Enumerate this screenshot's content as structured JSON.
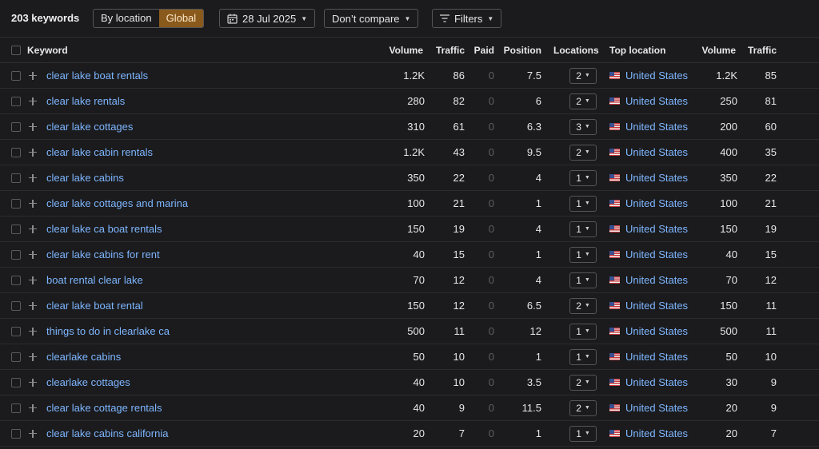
{
  "toolbar": {
    "count_label": "203 keywords",
    "by_location": "By location",
    "global": "Global",
    "date": "28 Jul 2025",
    "compare": "Don’t compare",
    "filters": "Filters"
  },
  "columns": {
    "keyword": "Keyword",
    "volume": "Volume",
    "traffic": "Traffic",
    "paid": "Paid",
    "position": "Position",
    "locations": "Locations",
    "top_location": "Top location",
    "top_volume": "Volume",
    "top_traffic": "Traffic"
  },
  "rows": [
    {
      "keyword": "clear lake boat rentals",
      "volume": "1.2K",
      "traffic": "86",
      "paid": "0",
      "position": "7.5",
      "locations": "2",
      "country": "United States",
      "top_volume": "1.2K",
      "top_traffic": "85"
    },
    {
      "keyword": "clear lake rentals",
      "volume": "280",
      "traffic": "82",
      "paid": "0",
      "position": "6",
      "locations": "2",
      "country": "United States",
      "top_volume": "250",
      "top_traffic": "81"
    },
    {
      "keyword": "clear lake cottages",
      "volume": "310",
      "traffic": "61",
      "paid": "0",
      "position": "6.3",
      "locations": "3",
      "country": "United States",
      "top_volume": "200",
      "top_traffic": "60"
    },
    {
      "keyword": "clear lake cabin rentals",
      "volume": "1.2K",
      "traffic": "43",
      "paid": "0",
      "position": "9.5",
      "locations": "2",
      "country": "United States",
      "top_volume": "400",
      "top_traffic": "35"
    },
    {
      "keyword": "clear lake cabins",
      "volume": "350",
      "traffic": "22",
      "paid": "0",
      "position": "4",
      "locations": "1",
      "country": "United States",
      "top_volume": "350",
      "top_traffic": "22"
    },
    {
      "keyword": "clear lake cottages and marina",
      "volume": "100",
      "traffic": "21",
      "paid": "0",
      "position": "1",
      "locations": "1",
      "country": "United States",
      "top_volume": "100",
      "top_traffic": "21"
    },
    {
      "keyword": "clear lake ca boat rentals",
      "volume": "150",
      "traffic": "19",
      "paid": "0",
      "position": "4",
      "locations": "1",
      "country": "United States",
      "top_volume": "150",
      "top_traffic": "19"
    },
    {
      "keyword": "clear lake cabins for rent",
      "volume": "40",
      "traffic": "15",
      "paid": "0",
      "position": "1",
      "locations": "1",
      "country": "United States",
      "top_volume": "40",
      "top_traffic": "15"
    },
    {
      "keyword": "boat rental clear lake",
      "volume": "70",
      "traffic": "12",
      "paid": "0",
      "position": "4",
      "locations": "1",
      "country": "United States",
      "top_volume": "70",
      "top_traffic": "12"
    },
    {
      "keyword": "clear lake boat rental",
      "volume": "150",
      "traffic": "12",
      "paid": "0",
      "position": "6.5",
      "locations": "2",
      "country": "United States",
      "top_volume": "150",
      "top_traffic": "11"
    },
    {
      "keyword": "things to do in clearlake ca",
      "volume": "500",
      "traffic": "11",
      "paid": "0",
      "position": "12",
      "locations": "1",
      "country": "United States",
      "top_volume": "500",
      "top_traffic": "11"
    },
    {
      "keyword": "clearlake cabins",
      "volume": "50",
      "traffic": "10",
      "paid": "0",
      "position": "1",
      "locations": "1",
      "country": "United States",
      "top_volume": "50",
      "top_traffic": "10"
    },
    {
      "keyword": "clearlake cottages",
      "volume": "40",
      "traffic": "10",
      "paid": "0",
      "position": "3.5",
      "locations": "2",
      "country": "United States",
      "top_volume": "30",
      "top_traffic": "9"
    },
    {
      "keyword": "clear lake cottage rentals",
      "volume": "40",
      "traffic": "9",
      "paid": "0",
      "position": "11.5",
      "locations": "2",
      "country": "United States",
      "top_volume": "20",
      "top_traffic": "9"
    },
    {
      "keyword": "clear lake cabins california",
      "volume": "20",
      "traffic": "7",
      "paid": "0",
      "position": "1",
      "locations": "1",
      "country": "United States",
      "top_volume": "20",
      "top_traffic": "7"
    }
  ]
}
